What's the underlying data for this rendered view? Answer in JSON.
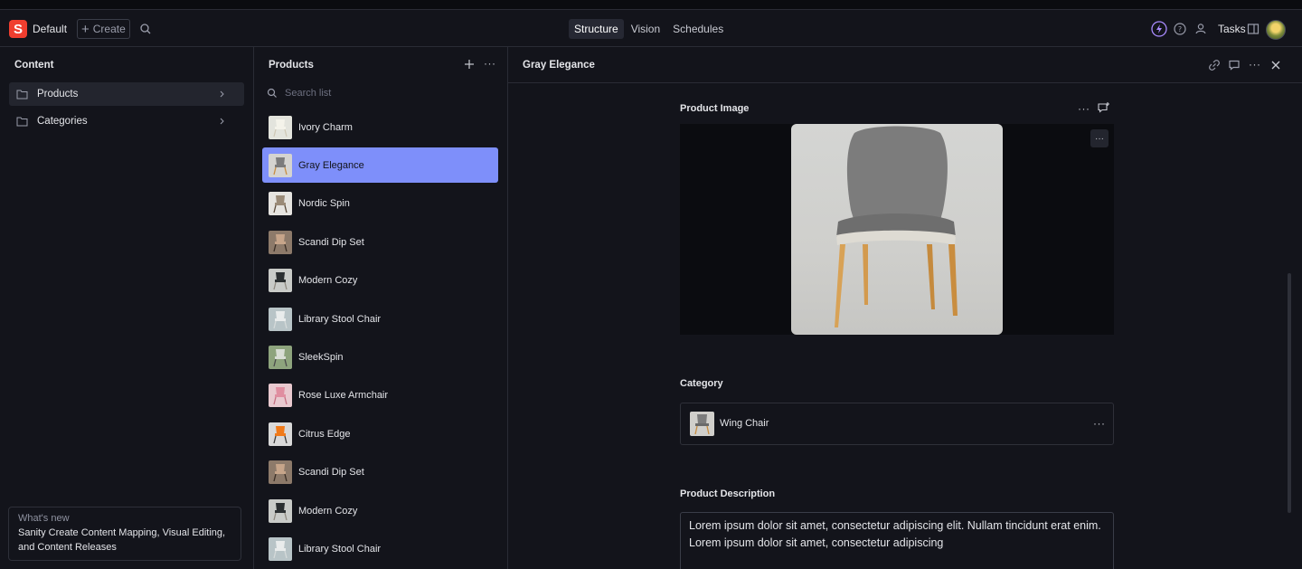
{
  "navbar": {
    "logo_letter": "S",
    "workspace": "Default",
    "create_label": "Create",
    "tabs": [
      "Structure",
      "Vision",
      "Schedules"
    ],
    "active_tab": "Structure",
    "tasks_label": "Tasks"
  },
  "content_pane": {
    "title": "Content",
    "items": [
      {
        "label": "Products",
        "selected": true
      },
      {
        "label": "Categories",
        "selected": false
      }
    ],
    "whats_new": {
      "heading": "What's new",
      "body": "Sanity Create Content Mapping, Visual Editing, and Content Releases"
    }
  },
  "products_pane": {
    "title": "Products",
    "search_placeholder": "Search list",
    "items": [
      {
        "label": "Ivory Charm",
        "thumb": "ivory"
      },
      {
        "label": "Gray Elegance",
        "thumb": "gray",
        "selected": true
      },
      {
        "label": "Nordic Spin",
        "thumb": "nordic"
      },
      {
        "label": "Scandi Dip Set",
        "thumb": "scandi"
      },
      {
        "label": "Modern Cozy",
        "thumb": "cozy"
      },
      {
        "label": "Library Stool Chair",
        "thumb": "library"
      },
      {
        "label": "SleekSpin",
        "thumb": "sleek"
      },
      {
        "label": "Rose Luxe Armchair",
        "thumb": "rose"
      },
      {
        "label": "Citrus Edge",
        "thumb": "citrus"
      },
      {
        "label": "Scandi Dip Set",
        "thumb": "scandi"
      },
      {
        "label": "Modern Cozy",
        "thumb": "cozy"
      },
      {
        "label": "Library Stool Chair",
        "thumb": "library"
      }
    ]
  },
  "document": {
    "title": "Gray Elegance",
    "product_image_label": "Product Image",
    "category_label": "Category",
    "category_value": "Wing Chair",
    "description_label": "Product Description",
    "description_value": "Lorem ipsum dolor sit amet, consectetur adipiscing elit. Nullam tincidunt erat enim. Lorem ipsum dolor sit amet, consectetur adipiscing"
  },
  "colors": {
    "accent": "#7e8ffa",
    "brand": "#f03e2f",
    "background": "#13141b"
  }
}
